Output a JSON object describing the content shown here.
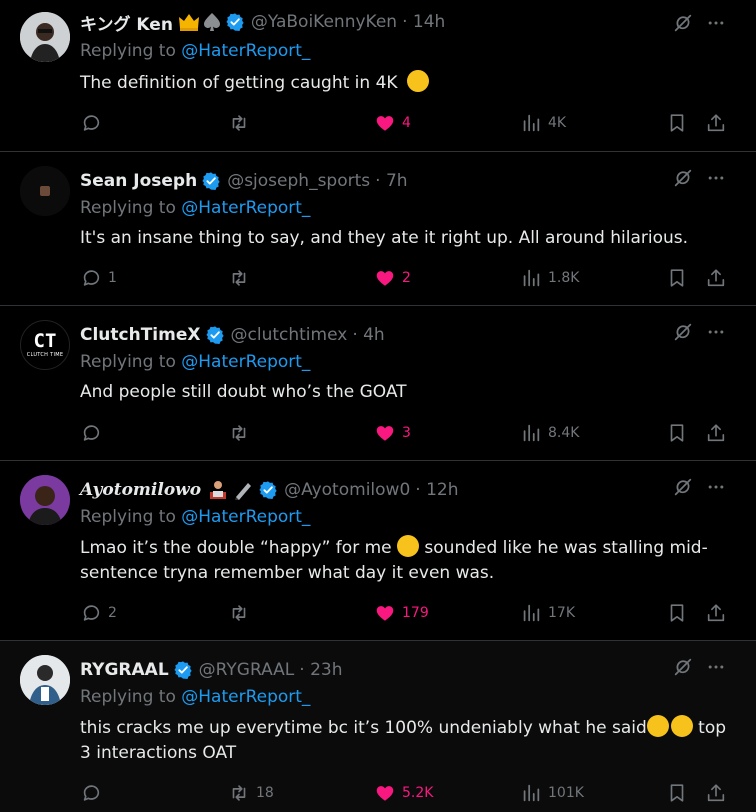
{
  "reply_prefix": "Replying to ",
  "tweets": [
    {
      "name": "キング Ken",
      "handle": "@YaBoiKennyKen",
      "time": "· 14h",
      "reply_to": "@HaterReport_",
      "text": "The definition of getting caught in 4K",
      "text_emoji": "rofl",
      "replies": "",
      "retweets": "",
      "likes": "4",
      "views": "4K"
    },
    {
      "name": "Sean Joseph",
      "handle": "@sjoseph_sports",
      "time": "· 7h",
      "reply_to": "@HaterReport_",
      "text": "It's an insane thing to say, and they ate it right up. All around hilarious.",
      "replies": "1",
      "retweets": "",
      "likes": "2",
      "views": "1.8K"
    },
    {
      "name": "ClutchTimeX",
      "handle": "@clutchtimex",
      "time": "· 4h",
      "reply_to": "@HaterReport_",
      "text": "And people still doubt who’s the GOAT",
      "replies": "",
      "retweets": "",
      "likes": "3",
      "views": "8.4K",
      "avatar_text": "CT",
      "avatar_subtext": "CLUTCH TIME"
    },
    {
      "name": "Ayotomilowo",
      "handle": "@Ayotomilow0",
      "time": "· 12h",
      "reply_to": "@HaterReport_",
      "text_a": "Lmao it’s the double “happy” for me",
      "text_b": " sounded like he was stalling mid-sentence tryna remember what day it even was.",
      "replies": "2",
      "retweets": "",
      "likes": "179",
      "views": "17K"
    },
    {
      "name": "RYGRAAL",
      "handle": "@RYGRAAL",
      "time": "· 23h",
      "reply_to": "@HaterReport_",
      "text_a": "this cracks me up everytime bc it’s 100% undeniably what he said",
      "text_b": " top 3 interactions OAT",
      "replies": "",
      "retweets": "18",
      "likes": "5.2K",
      "views": "101K"
    }
  ],
  "colors": {
    "background": "#000000",
    "text": "#e7e9ea",
    "muted": "#71767b",
    "link": "#1d9bf0",
    "like": "#f91880",
    "divider": "#2f3336",
    "verified": "#1d9bf0"
  }
}
